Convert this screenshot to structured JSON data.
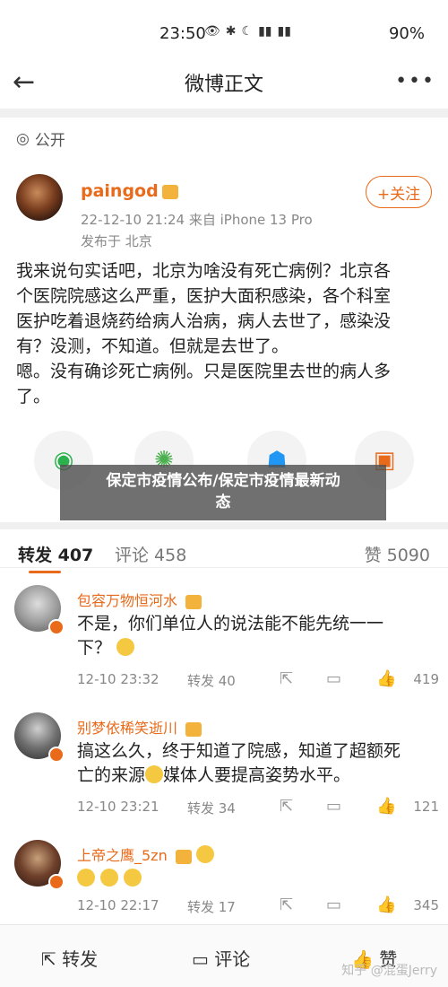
{
  "status_bar": {
    "time": "23:50",
    "battery": "90%"
  },
  "nav": {
    "title": "微博正文"
  },
  "post": {
    "visibility": "公开",
    "author": "paingod",
    "follow_label": "+关注",
    "meta": "22-12-10 21:24  来自 iPhone 13 Pro",
    "location": "发布于 北京",
    "body_lines": [
      "我来说句实话吧，北京为啥没有死亡病例？北京各",
      "个医院院感这么严重，医护大面积感染，各个科室",
      "医护吃着退烧药给病人治病，病人去世了，感染没",
      "有？没测，不知道。但就是去世了。",
      "嗯。没有确诊死亡病例。只是医院里去世的病人多",
      "了。"
    ]
  },
  "overlay": {
    "line1": "保定市疫情公布/保定市疫情最新动",
    "line2": "态"
  },
  "stats": {
    "repost": "转发 407",
    "comment": "评论 458",
    "like": "赞 5090"
  },
  "replies": [
    {
      "name": "包容万物恒河水",
      "text1": "不是，你们单位人的说法能不能先统一一",
      "text2": "下？",
      "time": "12-10 23:32",
      "repost": "转发 40",
      "likes": "419"
    },
    {
      "name": "别梦依稀笑逝川",
      "text1": "搞这么久，终于知道了院感，知道了超额死",
      "text2": "亡的来源",
      "text2b": "媒体人要提高姿势水平。",
      "time": "12-10 23:21",
      "repost": "转发 34",
      "likes": "121"
    },
    {
      "name": "上帝之鹰_5zn",
      "time": "12-10 22:17",
      "repost": "转发 17",
      "likes": "345"
    }
  ],
  "bottom": {
    "repost": "转发",
    "comment": "评论",
    "like": "赞",
    "watermark": "知乎 @混蛋Jerry"
  },
  "colors": {
    "accent": "#e86a1a"
  }
}
